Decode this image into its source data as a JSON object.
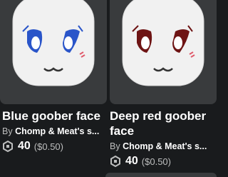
{
  "items": [
    {
      "name": "Blue goober face",
      "by_prefix": "By",
      "creator": "Chomp & Meat's s...",
      "price": "40",
      "usd": "($0.50)",
      "eye_color": "#2a55c9",
      "icon": "blue-goober-face-thumbnail"
    },
    {
      "name": "Deep red goober face",
      "by_prefix": "By",
      "creator": "Chomp & Meat's s...",
      "price": "40",
      "usd": "($0.50)",
      "eye_color": "#6e1414",
      "icon": "deep-red-goober-face-thumbnail"
    }
  ],
  "currency_icon": "robux-icon"
}
